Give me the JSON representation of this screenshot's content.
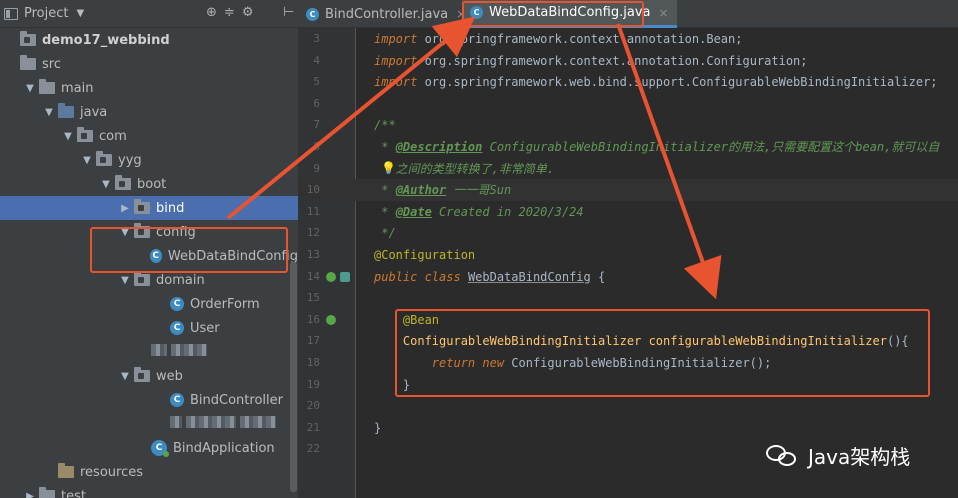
{
  "project_panel": {
    "title": "Project",
    "tree": [
      {
        "label": "demo17_webbind",
        "indent": 0,
        "arrow": "",
        "icon": "module-folder-icon",
        "bold": true
      },
      {
        "label": "src",
        "indent": 0,
        "arrow": "",
        "icon": "folder-icon"
      },
      {
        "label": "main",
        "indent": 1,
        "arrow": "▼",
        "icon": "folder-icon"
      },
      {
        "label": "java",
        "indent": 2,
        "arrow": "▼",
        "icon": "source-folder-icon"
      },
      {
        "label": "com",
        "indent": 3,
        "arrow": "▼",
        "icon": "package-icon"
      },
      {
        "label": "yyg",
        "indent": 4,
        "arrow": "▼",
        "icon": "package-icon"
      },
      {
        "label": "boot",
        "indent": 5,
        "arrow": "▼",
        "icon": "package-icon"
      },
      {
        "label": "bind",
        "indent": 6,
        "arrow": "▶",
        "icon": "package-icon",
        "selected": true
      },
      {
        "label": "config",
        "indent": 6,
        "arrow": "▼",
        "icon": "package-icon"
      },
      {
        "label": "WebDataBindConfig",
        "indent": 8,
        "arrow": "",
        "icon": "class-icon"
      },
      {
        "label": "domain",
        "indent": 6,
        "arrow": "▼",
        "icon": "package-icon"
      },
      {
        "label": "OrderForm",
        "indent": 8,
        "arrow": "",
        "icon": "class-icon"
      },
      {
        "label": "User",
        "indent": 8,
        "arrow": "",
        "icon": "class-icon"
      },
      {
        "label": "",
        "indent": 7,
        "arrow": "",
        "icon": "blurred",
        "blur": [
          16,
          36
        ]
      },
      {
        "label": "web",
        "indent": 6,
        "arrow": "▼",
        "icon": "package-icon"
      },
      {
        "label": "BindController",
        "indent": 8,
        "arrow": "",
        "icon": "class-icon"
      },
      {
        "label": "",
        "indent": 8,
        "arrow": "",
        "icon": "blurred",
        "blur": [
          12,
          50,
          36
        ]
      },
      {
        "label": "BindApplication",
        "indent": 7,
        "arrow": "",
        "icon": "spring-app-icon"
      },
      {
        "label": "resources",
        "indent": 2,
        "arrow": "",
        "icon": "resources-folder-icon"
      },
      {
        "label": "test",
        "indent": 1,
        "arrow": "▶",
        "icon": "folder-icon"
      }
    ]
  },
  "tabs": [
    {
      "label": "BindController.java",
      "active": false
    },
    {
      "label": "WebDataBindConfig.java",
      "active": true
    }
  ],
  "editor": {
    "lines": [
      {
        "n": "3",
        "html": "<span class=\"kw\">import</span> org.springframework.context.annotation.Bean;"
      },
      {
        "n": "4",
        "html": "<span class=\"kw\">import</span> org.springframework.context.annotation.Configuration;"
      },
      {
        "n": "5",
        "html": "<span class=\"kw\">import</span> org.springframework.web.bind.support.ConfigurableWebBindingInitializer;"
      },
      {
        "n": "6",
        "html": ""
      },
      {
        "n": "7",
        "html": "<span class=\"cmt\">/**</span>"
      },
      {
        "n": "8",
        "html": "<span class=\"cmt\"> * </span><span class=\"cmt-tag\">@Description</span><span class=\"cmt\"> ConfigurableWebBindingInitializer的用法,只需要配置这个bean,就可以自</span>"
      },
      {
        "n": "9",
        "html": "<span class=\"cmt\">   之间的类型转换了,非常简单.</span>"
      },
      {
        "n": "10",
        "html": "<span class=\"cmt\"> * </span><span class=\"cmt-tag\">@Author</span><span class=\"cmt\"> 一一哥Sun</span>"
      },
      {
        "n": "11",
        "html": "<span class=\"cmt\"> * </span><span class=\"cmt-tag\">@Date</span><span class=\"cmt\"> Created in 2020/3/24</span>"
      },
      {
        "n": "12",
        "html": "<span class=\"cmt\"> */</span>"
      },
      {
        "n": "13",
        "html": "<span class=\"ann\">@Configuration</span>"
      },
      {
        "n": "14",
        "html": "<span class=\"kw\">public class</span> <span class=\"cname\">WebDataBindConfig</span> {"
      },
      {
        "n": "15",
        "html": ""
      },
      {
        "n": "16",
        "html": "    <span class=\"ann\">@Bean</span>"
      },
      {
        "n": "17",
        "html": "    <span class=\"fn\">ConfigurableWebBindingInitializer</span> <span class=\"fn\">configurableWebBindingInitializer</span>(){"
      },
      {
        "n": "18",
        "html": "        <span class=\"kw\">return new</span> ConfigurableWebBindingInitializer();"
      },
      {
        "n": "19",
        "html": "    }"
      },
      {
        "n": "20",
        "html": ""
      },
      {
        "n": "21",
        "html": "}"
      },
      {
        "n": "22",
        "html": ""
      }
    ]
  },
  "watermark": "Java架构栈",
  "colors": {
    "highlight_box": "#e8542f",
    "selection": "#4b6eaf"
  }
}
